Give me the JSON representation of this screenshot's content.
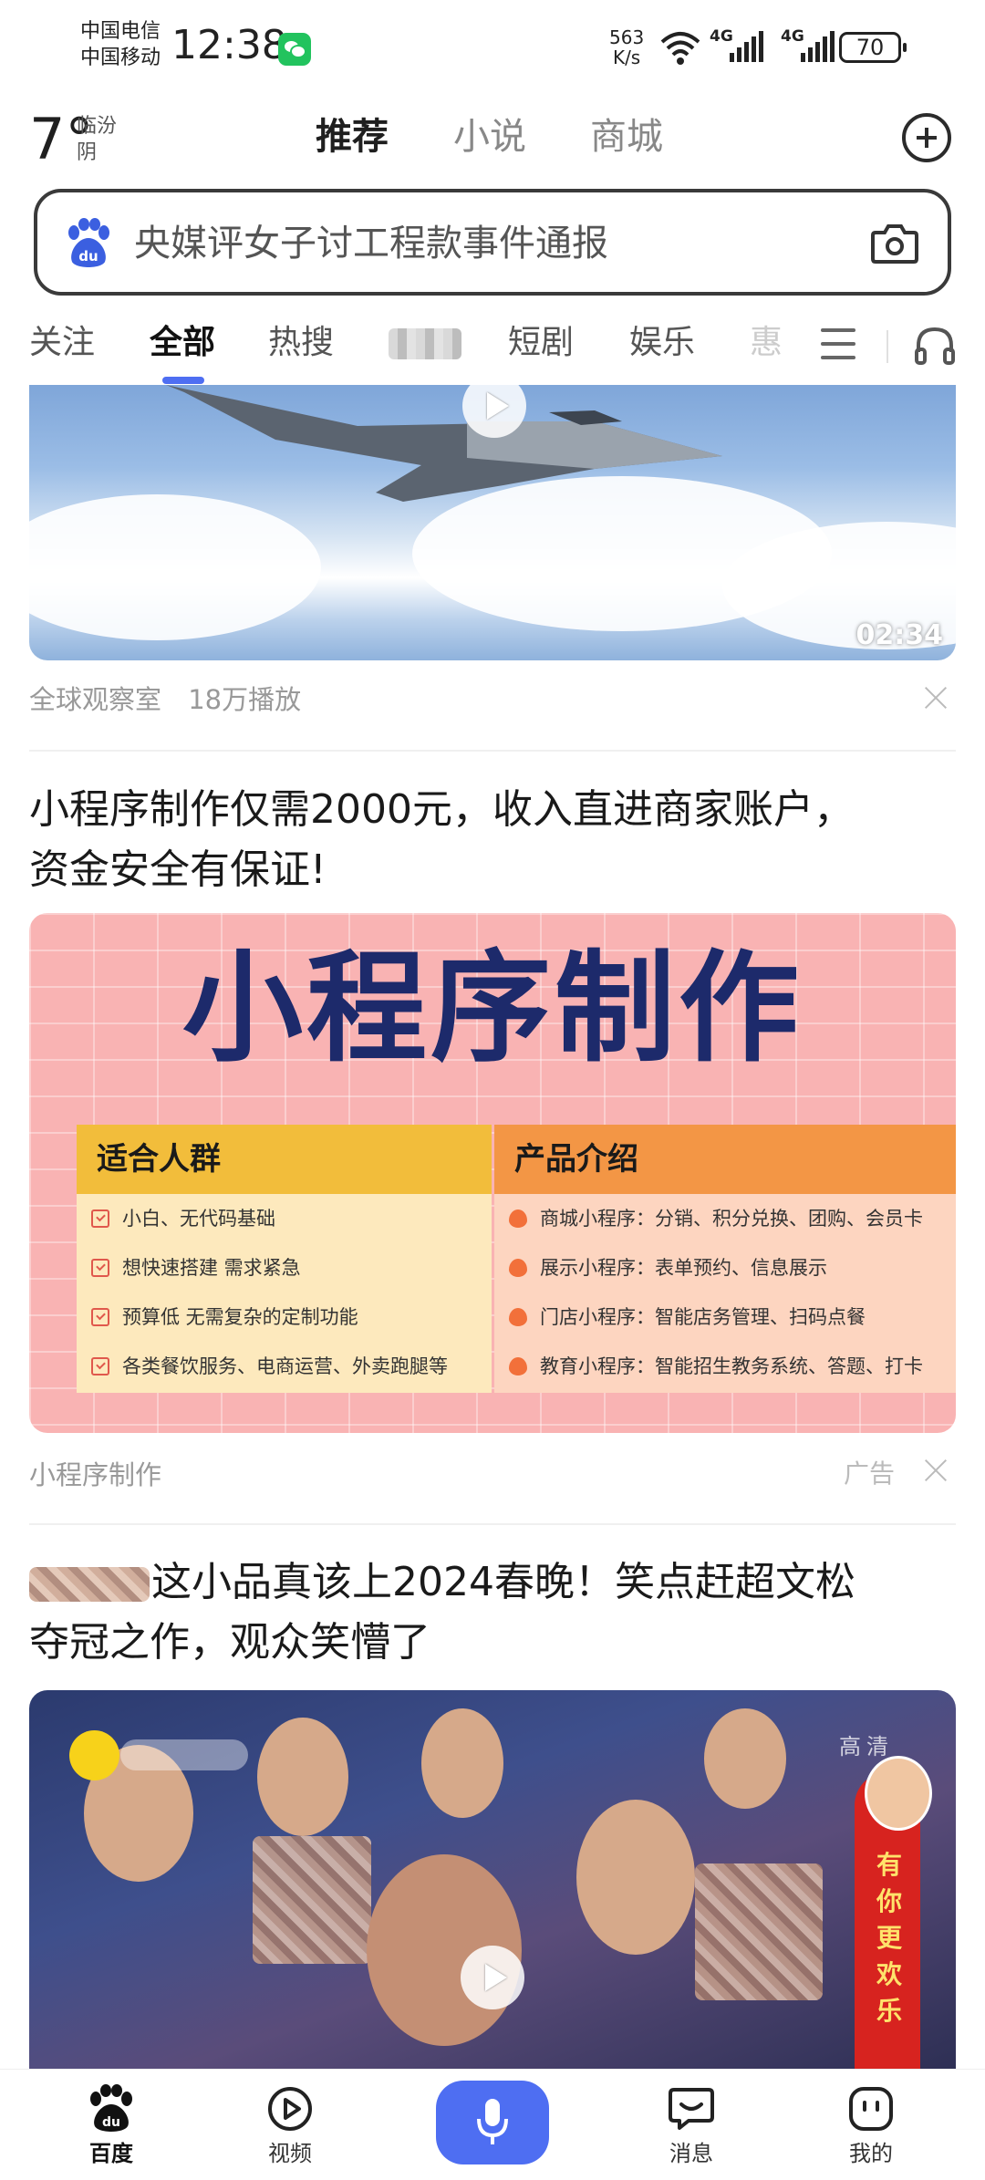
{
  "status_bar": {
    "carrier_1": "中国电信",
    "carrier_2": "中国移动",
    "time": "12:38",
    "net_speed_value": "563",
    "net_speed_unit": "K/s",
    "sim1_label": "4G",
    "sim2_label": "4G",
    "battery": "70"
  },
  "weather": {
    "temp": "7°",
    "city": "临汾",
    "condition": "阴"
  },
  "top_tabs": [
    "推荐",
    "小说",
    "商城"
  ],
  "search": {
    "placeholder": "央媒评女子讨工程款事件通报"
  },
  "channels": [
    "关注",
    "全部",
    "热搜",
    "短剧",
    "娱乐",
    "惠"
  ],
  "feed": {
    "item1": {
      "duration": "02:34",
      "source": "全球观察室",
      "plays": "18万播放"
    },
    "ad": {
      "title_line1": "小程序制作仅需2000元，收入直进商家账户，",
      "title_line2": "资金安全有保证!",
      "headline": "小程序制作",
      "left_header": "适合人群",
      "left_items": [
        "小白、无代码基础",
        "想快速搭建 需求紧急",
        "预算低 无需复杂的定制功能",
        "各类餐饮服务、电商运营、外卖跑腿等"
      ],
      "right_header": "产品介绍",
      "right_items": [
        "商城小程序：分销、积分兑换、团购、会员卡",
        "展示小程序：表单预约、信息展示",
        "门店小程序：智能店务管理、扫码点餐",
        "教育小程序：智能招生教务系统、答题、打卡"
      ],
      "source": "小程序制作",
      "tag": "广告"
    },
    "item3": {
      "title_line1": "这小品真该上2024春晚！笑点赶超文松",
      "title_line2": "夺冠之作，观众笑懵了",
      "hd": "高清",
      "promo": "有你更欢乐"
    }
  },
  "bottom_nav": {
    "home": "百度",
    "video": "视频",
    "messages": "消息",
    "mine": "我的"
  },
  "colors": {
    "accent": "#4e6ef2",
    "ad_navy": "#1d2a6b"
  }
}
